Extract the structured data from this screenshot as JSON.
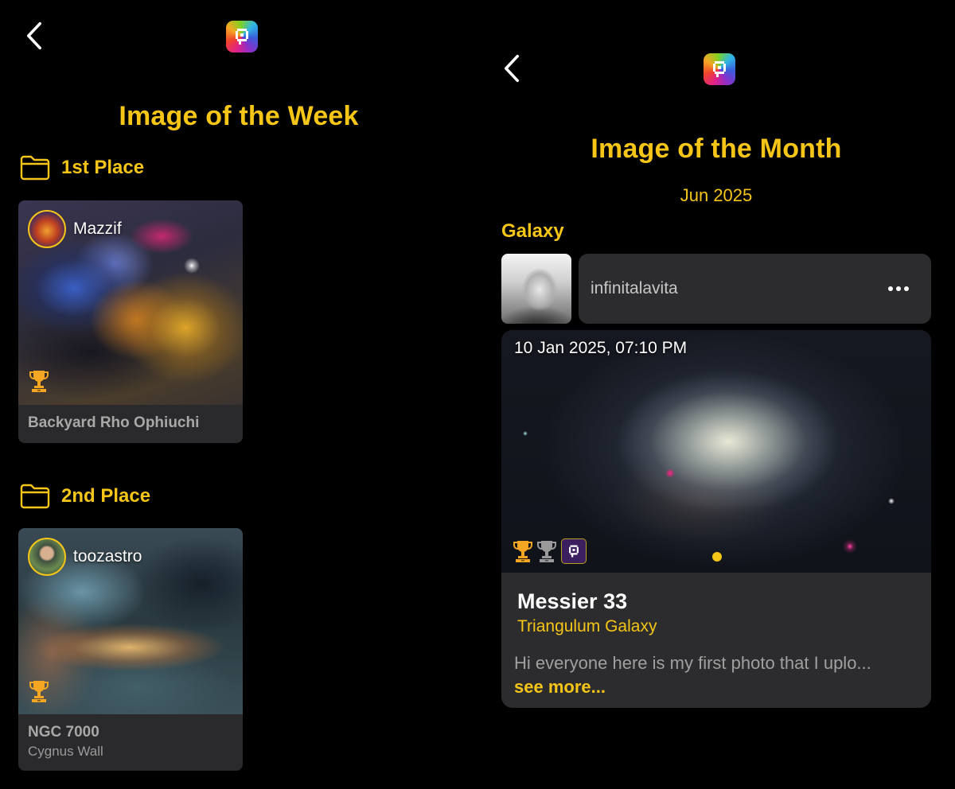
{
  "left_screen": {
    "title": "Image of the Week",
    "sections": [
      {
        "heading": "1st Place",
        "post": {
          "username": "Mazzif",
          "title": "Backyard Rho Ophiuchi",
          "subtitle": "",
          "award": "gold-trophy-icon"
        }
      },
      {
        "heading": "2nd Place",
        "post": {
          "username": "toozastro",
          "title": "NGC 7000",
          "subtitle": "Cygnus Wall",
          "award": "gold-trophy-icon"
        }
      }
    ]
  },
  "right_screen": {
    "title": "Image of the Month",
    "period": "Jun 2025",
    "category": "Galaxy",
    "post": {
      "username": "infinitalavita",
      "date": "10 Jan 2025, 07:10 PM",
      "title": "Messier 33",
      "subtitle": "Triangulum Galaxy",
      "description": "Hi everyone here is my first photo that I uplo...",
      "see_more": "see more...",
      "badges": [
        "gold-trophy-icon",
        "silver-trophy-icon",
        "app-badge-icon"
      ]
    }
  },
  "colors": {
    "accent": "#f5c518",
    "background": "#000000",
    "card": "#2c2c2e"
  },
  "icons": {
    "back": "chevron-left-icon",
    "logo": "app-logo-icon",
    "folder": "folder-icon",
    "more": "more-horizontal-icon"
  }
}
